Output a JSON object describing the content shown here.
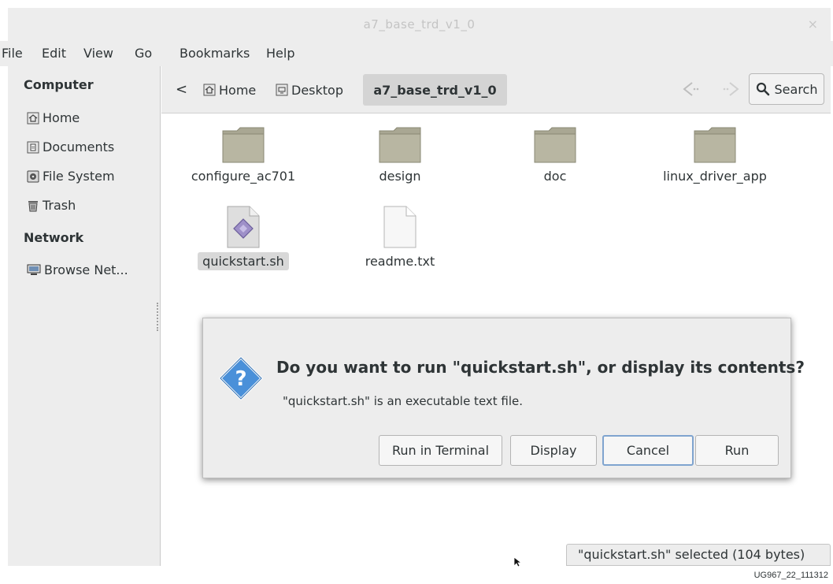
{
  "window": {
    "title": "a7_base_trd_v1_0",
    "close_glyph": "×"
  },
  "menubar": {
    "items": [
      "File",
      "Edit",
      "View",
      "Go",
      "Bookmarks",
      "Help"
    ]
  },
  "sidebar": {
    "sections": [
      {
        "header": "Computer",
        "items": [
          {
            "label": "Home",
            "icon": "home-icon"
          },
          {
            "label": "Documents",
            "icon": "documents-icon"
          },
          {
            "label": "File System",
            "icon": "drive-icon"
          },
          {
            "label": "Trash",
            "icon": "trash-icon"
          }
        ]
      },
      {
        "header": "Network",
        "items": [
          {
            "label": "Browse Net...",
            "icon": "network-icon"
          }
        ]
      }
    ]
  },
  "pathbar": {
    "back_glyph": "<",
    "crumbs": [
      {
        "label": "Home",
        "icon": "home-icon"
      },
      {
        "label": "Desktop",
        "icon": "desktop-icon"
      },
      {
        "label": "a7_base_trd_v1_0",
        "active": true
      }
    ],
    "search_label": "Search"
  },
  "files": [
    {
      "name": "configure_ac701",
      "type": "folder"
    },
    {
      "name": "design",
      "type": "folder"
    },
    {
      "name": "doc",
      "type": "folder"
    },
    {
      "name": "linux_driver_app",
      "type": "folder"
    },
    {
      "name": "quickstart.sh",
      "type": "script",
      "selected": true
    },
    {
      "name": "readme.txt",
      "type": "text"
    }
  ],
  "dialog": {
    "heading": "Do you want to run \"quickstart.sh\", or display its contents?",
    "message": "\"quickstart.sh\" is an executable text file.",
    "buttons": [
      "Run in Terminal",
      "Display",
      "Cancel",
      "Run"
    ],
    "focused": "Cancel"
  },
  "statusbar": {
    "text": "\"quickstart.sh\" selected (104 bytes)"
  },
  "figure_id": "UG967_22_111312",
  "colors": {
    "chrome": "#ededed",
    "dialog_icon": "#4a90d9",
    "folder": "#a4a28f"
  }
}
